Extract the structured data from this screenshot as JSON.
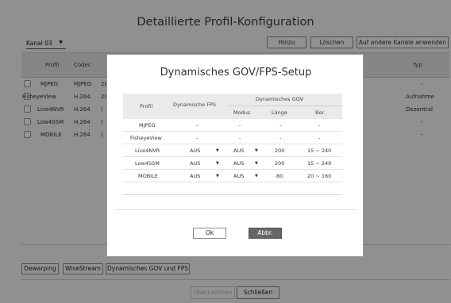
{
  "page": {
    "title": "Detaillierte Profil-Konfiguration",
    "channel_select": "Kanal 03"
  },
  "toolbar": {
    "add_label": "Hinzu",
    "delete_label": "Löschen",
    "apply_other_label": "Auf andere Kanäle anwenden"
  },
  "profile_table": {
    "headers": {
      "profile": "Profil",
      "codec": "Codec",
      "type": "Typ"
    },
    "rows": [
      {
        "profile": "MJPEG",
        "codec": "MJPEG",
        "res": "20",
        "type": "-"
      },
      {
        "profile": "FisheyeView",
        "codec": "H.264",
        "res": "20",
        "type": "Aufnahme"
      },
      {
        "profile": "Live4NVR",
        "codec": "H.264",
        "res": "(",
        "type": "Dezentral"
      },
      {
        "profile": "Low4SSM",
        "codec": "H.264",
        "res": "(",
        "type": "-"
      },
      {
        "profile": "MOBILE",
        "codec": "H.264",
        "res": "(",
        "type": "-"
      }
    ]
  },
  "tabs": {
    "dewarping": "Dewarping",
    "wisestream": "WiseStream",
    "gov_fps": "Dynamisches GOV und FPS"
  },
  "footer": {
    "apply_label": "Übernehmen",
    "close_label": "Schließen"
  },
  "modal": {
    "title": "Dynamisches GOV/FPS-Setup",
    "headers": {
      "profile": "Profil",
      "dynamic_fps": "Dynamische FPS",
      "dynamic_gov": "Dynamisches GOV",
      "mode": "Modus",
      "length": "Länge",
      "range": "Ber."
    },
    "dropdown_glyph": "▼",
    "rows": [
      {
        "profile": "MJPEG",
        "fps": "-",
        "mode": "-",
        "length": "-",
        "range": "-"
      },
      {
        "profile": "FisheyeView",
        "fps": "-",
        "mode": "-",
        "length": "-",
        "range": "-"
      },
      {
        "profile": "Live4NVR",
        "fps": "AUS",
        "mode": "AUS",
        "length": "200",
        "range": "15 ~ 240"
      },
      {
        "profile": "Low4SSM",
        "fps": "AUS",
        "mode": "AUS",
        "length": "200",
        "range": "15 ~ 240"
      },
      {
        "profile": "MOBILE",
        "fps": "AUS",
        "mode": "AUS",
        "length": "80",
        "range": "20 ~ 160"
      }
    ],
    "ok_label": "Ok",
    "cancel_label": "Abbr."
  }
}
